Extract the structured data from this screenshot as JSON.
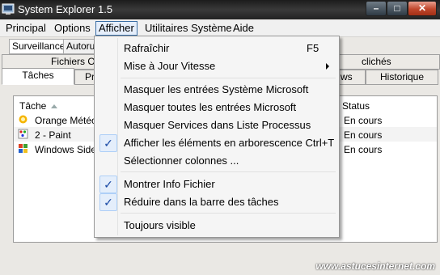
{
  "window": {
    "title": "System Explorer 1.5"
  },
  "menubar": {
    "items": [
      "Principal",
      "Options",
      "Afficher",
      "Utilitaires Système",
      "Aide"
    ]
  },
  "subtabs": [
    "Surveillance",
    "Autorun"
  ],
  "tabs_row1": [
    "Fichiers Ou",
    "clichés"
  ],
  "tabs_row2": [
    "Tâches",
    "Pro",
    "ws",
    "Historique"
  ],
  "list": {
    "columns": [
      "Tâche",
      "Status"
    ],
    "rows": [
      {
        "name": "Orange Météo",
        "status": "En cours"
      },
      {
        "name": "2 - Paint",
        "status": "En cours"
      },
      {
        "name": "Windows Sideb",
        "status": "En cours"
      }
    ]
  },
  "dropdown": {
    "items": [
      {
        "label": "Rafraîchir",
        "shortcut": "F5",
        "checked": false
      },
      {
        "label": "Mise à Jour Vitesse",
        "submenu": true,
        "checked": false
      },
      {
        "label": "Masquer les entrées Système Microsoft",
        "checked": false
      },
      {
        "label": "Masquer toutes les entrées Microsoft",
        "checked": false
      },
      {
        "label": "Masquer Services dans Liste Processus",
        "checked": false
      },
      {
        "label": "Afficher les éléments en arborescence Ctrl+T",
        "checked": true
      },
      {
        "label": "Sélectionner colonnes ...",
        "checked": false
      },
      {
        "label": "Montrer Info Fichier",
        "checked": true
      },
      {
        "label": "Réduire dans la barre des tâches",
        "checked": true
      },
      {
        "label": "Toujours visible",
        "checked": false
      }
    ],
    "check_glyph": "✓"
  },
  "watermark": "www.astucesinternet.com",
  "colors": {
    "menu_highlight": "#e5eefb",
    "check_blue": "#1a4aa5"
  }
}
